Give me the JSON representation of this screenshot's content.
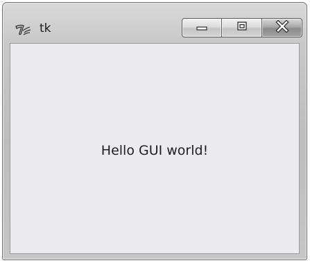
{
  "window": {
    "title": "tk",
    "app_icon": "tk-feather-icon",
    "controls": {
      "minimize_icon": "minimize-icon",
      "maximize_icon": "maximize-icon",
      "close_icon": "close-icon"
    }
  },
  "content": {
    "label_text": "Hello GUI world!"
  }
}
